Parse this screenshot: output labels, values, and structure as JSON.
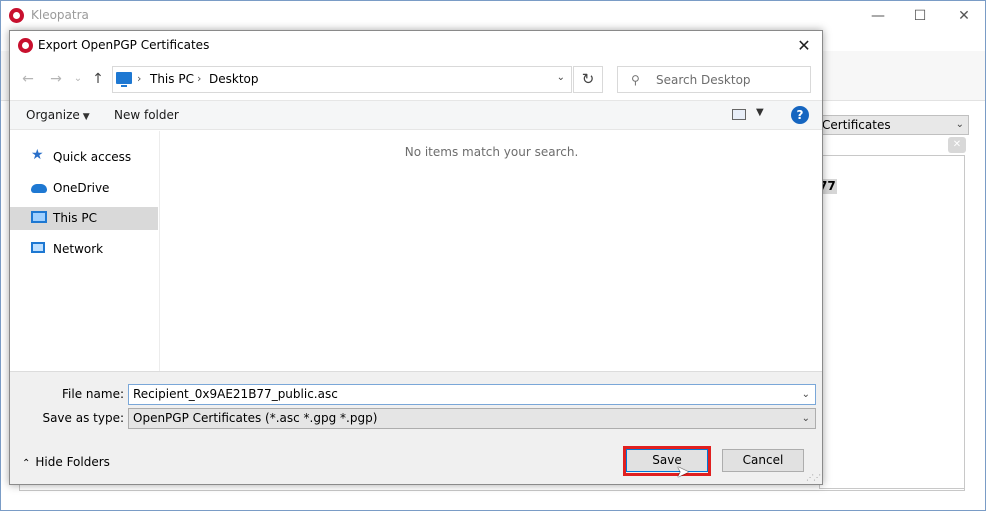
{
  "background_window": {
    "title": "Kleopatra",
    "controls": {
      "minimize": "—",
      "maximize": "☐",
      "close": "✕"
    },
    "filter_combo": " Certificates",
    "table_cell": "77",
    "clear_glyph": "✕"
  },
  "dialog": {
    "title": "Export OpenPGP Certificates",
    "close_glyph": "✕",
    "nav": {
      "back": "←",
      "forward": "→",
      "recent": "⌄",
      "up": "↑"
    },
    "address": {
      "parts": [
        "This PC",
        "Desktop"
      ],
      "separator": "›",
      "dropdown": "⌄",
      "refresh": "↻"
    },
    "search": {
      "placeholder": "Search Desktop",
      "icon": "⚲"
    },
    "toolbar": {
      "organize": "Organize",
      "organize_caret": "▼",
      "new_folder": "New folder",
      "view_caret": "▼",
      "help": "?"
    },
    "sidebar": {
      "items": [
        {
          "label": "Quick access",
          "icon": "star-icon"
        },
        {
          "label": "OneDrive",
          "icon": "cloud-icon"
        },
        {
          "label": "This PC",
          "icon": "computer-icon",
          "selected": true
        },
        {
          "label": "Network",
          "icon": "network-icon"
        }
      ]
    },
    "content": {
      "empty_message": "No items match your search."
    },
    "fields": {
      "filename_label": "File name:",
      "filename_value": "Recipient_0x9AE21B77_public.asc",
      "savetype_label": "Save as type:",
      "savetype_value": "OpenPGP Certificates (*.asc *.gpg *.pgp)",
      "dropdown_glyph": "⌄"
    },
    "footer": {
      "hide_folders": "Hide Folders",
      "hide_caret": "⌃",
      "save": "Save",
      "cancel": "Cancel"
    }
  },
  "colors": {
    "accent": "#0078d7",
    "highlight": "#e02020",
    "brand": "#c8102e",
    "help": "#1565c0"
  }
}
